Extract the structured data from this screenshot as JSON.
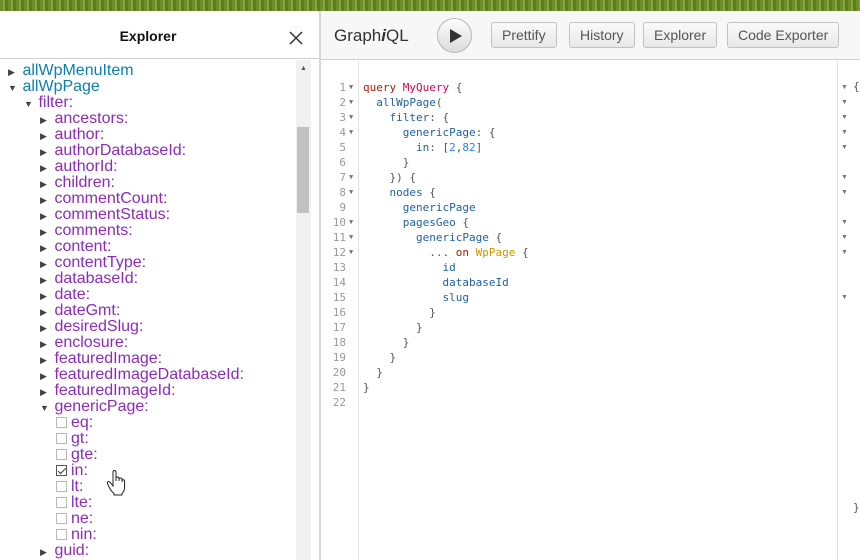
{
  "explorer": {
    "title": "Explorer",
    "tree": [
      {
        "indent": 0,
        "arrow": "▶",
        "label": "allWpMenuItem",
        "kind": "root",
        "top": 0
      },
      {
        "indent": 0,
        "arrow": "▼",
        "label": "allWpPage",
        "kind": "root"
      },
      {
        "indent": 1,
        "arrow": "▼",
        "label": "filter:",
        "kind": "arg"
      },
      {
        "indent": 2,
        "arrow": "▶",
        "label": "ancestors:",
        "kind": "arg"
      },
      {
        "indent": 2,
        "arrow": "▶",
        "label": "author:",
        "kind": "arg"
      },
      {
        "indent": 2,
        "arrow": "▶",
        "label": "authorDatabaseId:",
        "kind": "arg"
      },
      {
        "indent": 2,
        "arrow": "▶",
        "label": "authorId:",
        "kind": "arg"
      },
      {
        "indent": 2,
        "arrow": "▶",
        "label": "children:",
        "kind": "arg"
      },
      {
        "indent": 2,
        "arrow": "▶",
        "label": "commentCount:",
        "kind": "arg"
      },
      {
        "indent": 2,
        "arrow": "▶",
        "label": "commentStatus:",
        "kind": "arg"
      },
      {
        "indent": 2,
        "arrow": "▶",
        "label": "comments:",
        "kind": "arg"
      },
      {
        "indent": 2,
        "arrow": "▶",
        "label": "content:",
        "kind": "arg"
      },
      {
        "indent": 2,
        "arrow": "▶",
        "label": "contentType:",
        "kind": "arg"
      },
      {
        "indent": 2,
        "arrow": "▶",
        "label": "databaseId:",
        "kind": "arg"
      },
      {
        "indent": 2,
        "arrow": "▶",
        "label": "date:",
        "kind": "arg"
      },
      {
        "indent": 2,
        "arrow": "▶",
        "label": "dateGmt:",
        "kind": "arg"
      },
      {
        "indent": 2,
        "arrow": "▶",
        "label": "desiredSlug:",
        "kind": "arg"
      },
      {
        "indent": 2,
        "arrow": "▶",
        "label": "enclosure:",
        "kind": "arg"
      },
      {
        "indent": 2,
        "arrow": "▶",
        "label": "featuredImage:",
        "kind": "arg"
      },
      {
        "indent": 2,
        "arrow": "▶",
        "label": "featuredImageDatabaseId:",
        "kind": "arg"
      },
      {
        "indent": 2,
        "arrow": "▶",
        "label": "featuredImageId:",
        "kind": "arg"
      },
      {
        "indent": 2,
        "arrow": "▼",
        "label": "genericPage:",
        "kind": "arg"
      },
      {
        "indent": 3,
        "check": false,
        "label": "eq:",
        "kind": "arg"
      },
      {
        "indent": 3,
        "check": false,
        "label": "gt:",
        "kind": "arg"
      },
      {
        "indent": 3,
        "check": false,
        "label": "gte:",
        "kind": "arg"
      },
      {
        "indent": 3,
        "check": true,
        "label": "in:",
        "kind": "arg"
      },
      {
        "indent": 3,
        "check": false,
        "label": "lt:",
        "kind": "arg"
      },
      {
        "indent": 3,
        "check": false,
        "label": "lte:",
        "kind": "arg"
      },
      {
        "indent": 3,
        "check": false,
        "label": "ne:",
        "kind": "arg"
      },
      {
        "indent": 3,
        "check": false,
        "label": "nin:",
        "kind": "arg"
      },
      {
        "indent": 2,
        "arrow": "▶",
        "label": "guid:",
        "kind": "arg"
      }
    ]
  },
  "toolbar": {
    "logo_prefix": "Graph",
    "logo_italic": "i",
    "logo_suffix": "QL",
    "buttons": [
      "Prettify",
      "History",
      "Explorer",
      "Code Exporter"
    ]
  },
  "editor": {
    "lines": [
      {
        "n": "1",
        "fold": true,
        "tokens": [
          [
            "kw",
            "query "
          ],
          [
            "def",
            "MyQuery"
          ],
          [
            "punc",
            " {"
          ]
        ]
      },
      {
        "n": "2",
        "fold": true,
        "tokens": [
          [
            "prop",
            "  allWpPage"
          ],
          [
            "punc",
            "("
          ]
        ]
      },
      {
        "n": "3",
        "fold": true,
        "tokens": [
          [
            "prop",
            "    filter"
          ],
          [
            "punc",
            ": {"
          ]
        ]
      },
      {
        "n": "4",
        "fold": true,
        "tokens": [
          [
            "prop",
            "      genericPage"
          ],
          [
            "punc",
            ": {"
          ]
        ]
      },
      {
        "n": "5",
        "fold": false,
        "tokens": [
          [
            "prop",
            "        in"
          ],
          [
            "punc",
            ": ["
          ],
          [
            "num",
            "2"
          ],
          [
            "punc",
            ","
          ],
          [
            "num",
            "82"
          ],
          [
            "punc",
            "]"
          ]
        ]
      },
      {
        "n": "6",
        "fold": false,
        "tokens": [
          [
            "punc",
            "      }"
          ]
        ]
      },
      {
        "n": "7",
        "fold": true,
        "tokens": [
          [
            "punc",
            "    }) {"
          ]
        ]
      },
      {
        "n": "8",
        "fold": true,
        "tokens": [
          [
            "prop",
            "    nodes"
          ],
          [
            "punc",
            " {"
          ]
        ]
      },
      {
        "n": "9",
        "fold": false,
        "tokens": [
          [
            "prop",
            "      genericPage"
          ]
        ]
      },
      {
        "n": "10",
        "fold": true,
        "tokens": [
          [
            "prop",
            "      pagesGeo"
          ],
          [
            "punc",
            " {"
          ]
        ]
      },
      {
        "n": "11",
        "fold": true,
        "tokens": [
          [
            "prop",
            "        genericPage"
          ],
          [
            "punc",
            " {"
          ]
        ]
      },
      {
        "n": "12",
        "fold": true,
        "tokens": [
          [
            "punc",
            "          ... "
          ],
          [
            "kw",
            "on "
          ],
          [
            "type",
            "WpPage"
          ],
          [
            "punc",
            " {"
          ]
        ]
      },
      {
        "n": "13",
        "fold": false,
        "tokens": [
          [
            "prop",
            "            id"
          ]
        ]
      },
      {
        "n": "14",
        "fold": false,
        "tokens": [
          [
            "prop",
            "            databaseId"
          ]
        ]
      },
      {
        "n": "15",
        "fold": false,
        "tokens": [
          [
            "prop",
            "            slug"
          ]
        ]
      },
      {
        "n": "16",
        "fold": false,
        "tokens": [
          [
            "punc",
            "          }"
          ]
        ]
      },
      {
        "n": "17",
        "fold": false,
        "tokens": [
          [
            "punc",
            "        }"
          ]
        ]
      },
      {
        "n": "18",
        "fold": false,
        "tokens": [
          [
            "punc",
            "      }"
          ]
        ]
      },
      {
        "n": "19",
        "fold": false,
        "tokens": [
          [
            "punc",
            "    }"
          ]
        ]
      },
      {
        "n": "20",
        "fold": false,
        "tokens": [
          [
            "punc",
            "  }"
          ]
        ]
      },
      {
        "n": "21",
        "fold": false,
        "tokens": [
          [
            "punc",
            "}"
          ]
        ]
      },
      {
        "n": "22",
        "fold": false,
        "tokens": []
      }
    ]
  },
  "result": {
    "open_brace": "{",
    "close_brace": "}",
    "fold_rows": [
      1,
      2,
      3,
      4,
      5,
      7,
      8,
      10,
      11,
      12,
      15
    ]
  }
}
